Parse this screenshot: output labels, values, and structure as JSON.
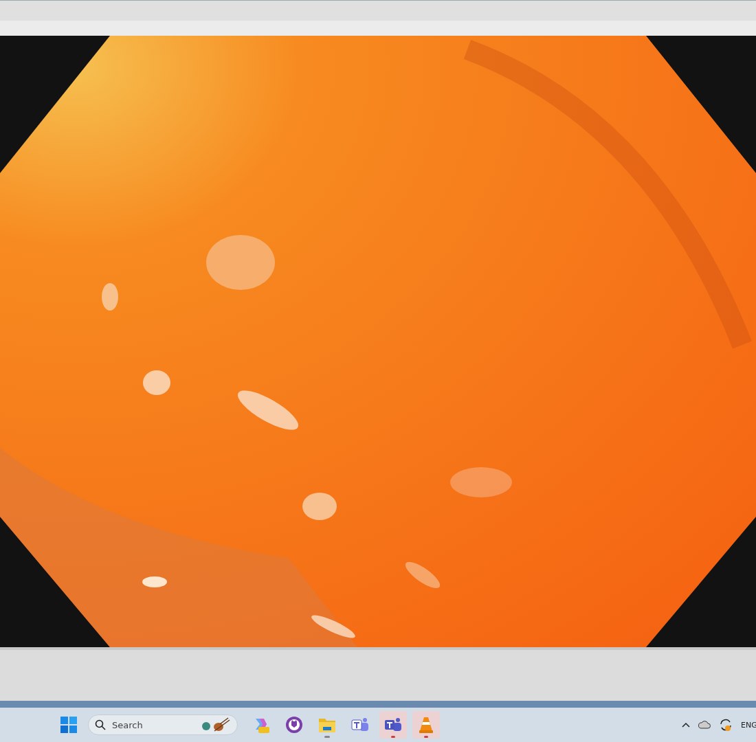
{
  "taskbar": {
    "search": {
      "placeholder": "Search"
    },
    "apps": [
      {
        "kind": "copilot",
        "running": false,
        "flashing": false
      },
      {
        "kind": "github",
        "running": false,
        "flashing": false
      },
      {
        "kind": "folder",
        "running": true,
        "flashing": false
      },
      {
        "kind": "teams-classic",
        "running": false,
        "flashing": false
      },
      {
        "kind": "teams",
        "running": true,
        "flashing": true
      },
      {
        "kind": "cone",
        "running": true,
        "flashing": true
      }
    ],
    "tray": {
      "language": "ENG"
    }
  }
}
